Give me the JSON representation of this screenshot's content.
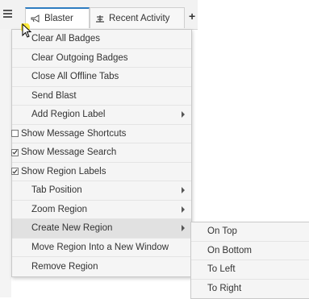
{
  "tabs": [
    {
      "label": "Blaster",
      "icon": "megaphone-icon"
    },
    {
      "label": "Recent Activity",
      "icon": "scale-icon"
    }
  ],
  "add_tab_label": "+",
  "menu": {
    "items": [
      {
        "label": "Clear All Badges"
      },
      {
        "label": "Clear Outgoing Badges"
      },
      {
        "label": "Close All Offline Tabs"
      },
      {
        "label": "Send Blast"
      },
      {
        "label": "Add Region Label",
        "submenu": true
      },
      {
        "label": "Show Message Shortcuts",
        "checked": false
      },
      {
        "label": "Show Message Search",
        "checked": true
      },
      {
        "label": "Show Region Labels",
        "checked": true
      },
      {
        "label": "Tab Position",
        "submenu": true
      },
      {
        "label": "Zoom Region",
        "submenu": true
      },
      {
        "label": "Create New Region",
        "submenu": true,
        "active": true
      },
      {
        "label": "Move Region Into a New Window"
      },
      {
        "label": "Remove Region"
      }
    ]
  },
  "submenu": {
    "items": [
      {
        "label": "On Top"
      },
      {
        "label": "On Bottom"
      },
      {
        "label": "To Left"
      },
      {
        "label": "To Right"
      }
    ]
  },
  "colors": {
    "accent": "#2e7dc1",
    "menu_bg": "#f5f5f5",
    "active_bg": "#e1e1e1",
    "cursor_glow": "#ffe600"
  }
}
